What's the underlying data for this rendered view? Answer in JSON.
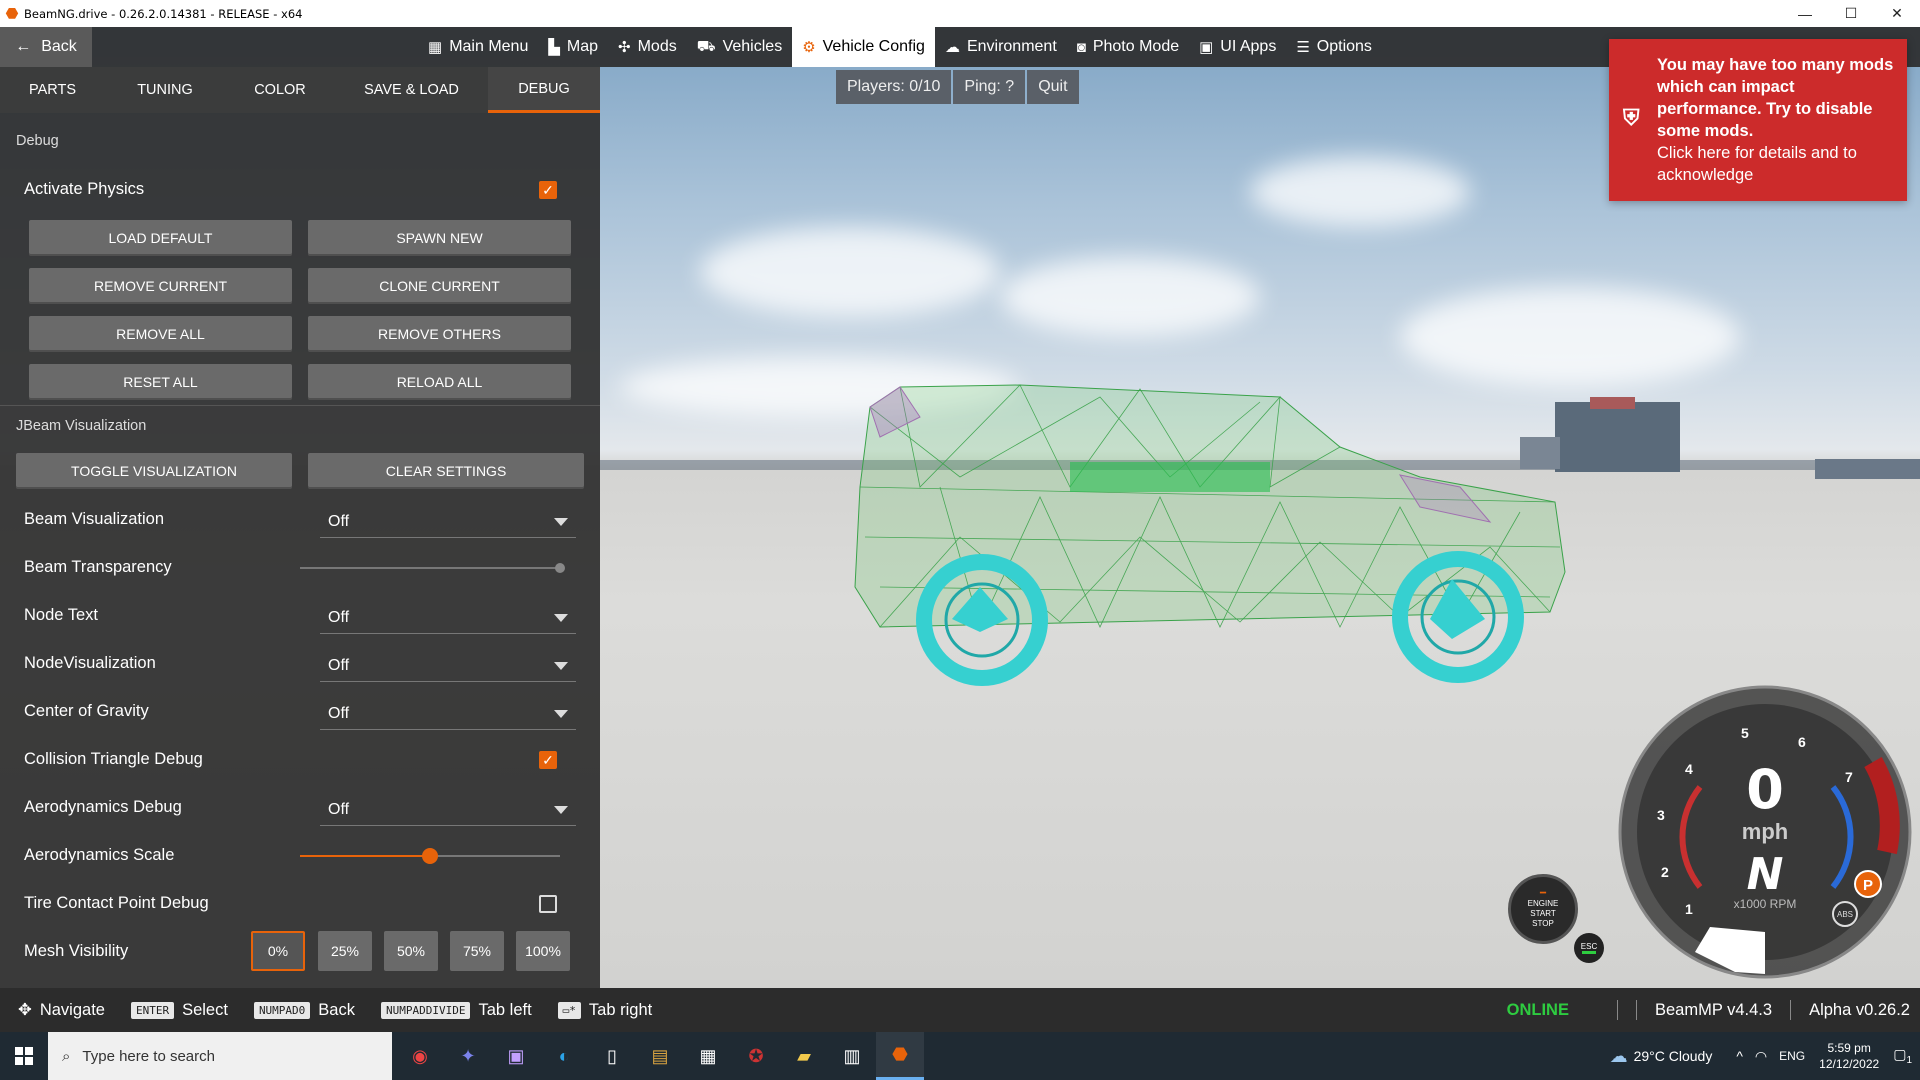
{
  "window": {
    "title": "BeamNG.drive - 0.26.2.0.14381 - RELEASE - x64",
    "minimize": "—",
    "maximize": "☐",
    "close": "✕"
  },
  "topnav": {
    "back_label": "Back",
    "items": [
      {
        "label": "Main Menu",
        "icon": "main-menu-icon"
      },
      {
        "label": "Map",
        "icon": "map-icon"
      },
      {
        "label": "Mods",
        "icon": "puzzle-icon"
      },
      {
        "label": "Vehicles",
        "icon": "car-icon"
      },
      {
        "label": "Vehicle Config",
        "icon": "engine-icon",
        "active": true
      },
      {
        "label": "Environment",
        "icon": "weather-icon"
      },
      {
        "label": "Photo Mode",
        "icon": "camera-icon"
      },
      {
        "label": "UI Apps",
        "icon": "ui-apps-icon"
      },
      {
        "label": "Options",
        "icon": "sliders-icon"
      }
    ]
  },
  "tabs": [
    "PARTS",
    "TUNING",
    "COLOR",
    "SAVE & LOAD",
    "DEBUG"
  ],
  "debug": {
    "section_title": "Debug",
    "activate_physics": {
      "label": "Activate Physics",
      "checked": true
    },
    "buttons": {
      "load_default": "LOAD DEFAULT",
      "spawn_new": "SPAWN NEW",
      "remove_current": "REMOVE CURRENT",
      "clone_current": "CLONE CURRENT",
      "remove_all": "REMOVE ALL",
      "remove_others": "REMOVE OTHERS",
      "reset_all": "RESET ALL",
      "reload_all": "RELOAD ALL"
    }
  },
  "jbeam": {
    "section_title": "JBeam Visualization",
    "toggle_visualization": "TOGGLE VISUALIZATION",
    "clear_settings": "CLEAR SETTINGS",
    "beam_visualization": {
      "label": "Beam Visualization",
      "value": "Off"
    },
    "beam_transparency": {
      "label": "Beam Transparency",
      "value": 1.0
    },
    "node_text": {
      "label": "Node Text",
      "value": "Off"
    },
    "node_visualization": {
      "label": "NodeVisualization",
      "value": "Off"
    },
    "center_of_gravity": {
      "label": "Center of Gravity",
      "value": "Off"
    },
    "collision_triangle_debug": {
      "label": "Collision Triangle Debug",
      "checked": true
    },
    "aerodynamics_debug": {
      "label": "Aerodynamics Debug",
      "value": "Off"
    },
    "aerodynamics_scale": {
      "label": "Aerodynamics Scale",
      "value": 0.5
    },
    "tire_contact_point_debug": {
      "label": "Tire Contact Point Debug",
      "checked": false
    },
    "mesh_visibility": {
      "label": "Mesh Visibility",
      "options": [
        "0%",
        "25%",
        "50%",
        "75%",
        "100%"
      ],
      "selected": "0%"
    }
  },
  "multiplayer": {
    "players": "Players: 0/10",
    "ping": "Ping: ?",
    "quit": "Quit"
  },
  "notice": {
    "headline": "You may have too many mods which can impact performance. Try to disable some mods.",
    "sub": "Click here for details and to acknowledge"
  },
  "gauge": {
    "speed": "0",
    "unit": "mph",
    "gear": "N",
    "rpm_label": "x1000 RPM",
    "ticks": [
      "1",
      "2",
      "3",
      "4",
      "5",
      "6",
      "7"
    ],
    "park": "P",
    "abs": "ABS"
  },
  "engine_button": {
    "line1": "ENGINE",
    "line2": "START",
    "line3": "STOP"
  },
  "esc_button": "ESC",
  "hints": [
    {
      "key": "",
      "label": "Navigate"
    },
    {
      "key": "ENTER",
      "label": "Select"
    },
    {
      "key": "NUMPAD0",
      "label": "Back"
    },
    {
      "key": "NUMPADDIVIDE",
      "label": "Tab left"
    },
    {
      "key": "",
      "label": "Tab right"
    }
  ],
  "status": {
    "online": "ONLINE",
    "beammp": "BeamMP v4.4.3",
    "alpha": "Alpha v0.26.2"
  },
  "taskbar": {
    "search_placeholder": "Type here to search",
    "weather": "29°C  Cloudy",
    "lang": "ENG",
    "time": "5:59 pm",
    "date": "12/12/2022",
    "notifications": "1"
  }
}
